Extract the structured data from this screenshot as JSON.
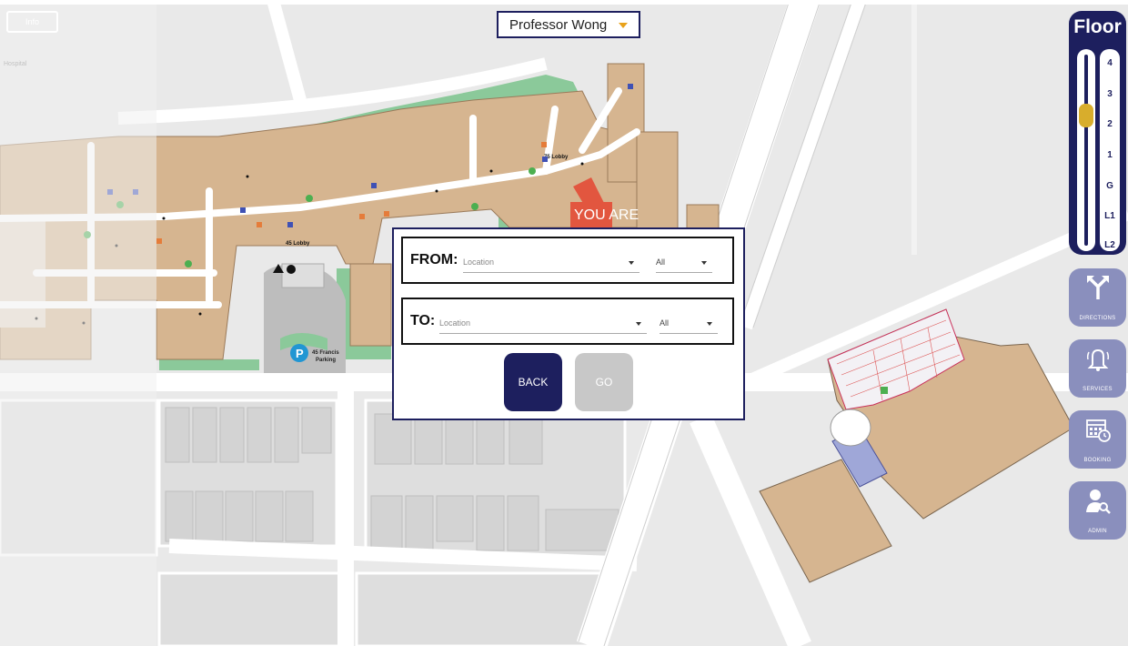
{
  "header": {
    "info_label": "Info",
    "user_name": "Professor Wong"
  },
  "map": {
    "you_are_here": "YOU ARE",
    "parking_label": "45 Francis Parking",
    "lobby_75": "75 Lobby",
    "lobby_45": "45 Lobby",
    "hospital_label": "Hospital"
  },
  "floor": {
    "title": "Floor",
    "levels": [
      "4",
      "3",
      "2",
      "1",
      "G",
      "L1",
      "L2"
    ],
    "selected": "2"
  },
  "side_buttons": [
    {
      "label": "DIRECTIONS",
      "icon": "directions-icon"
    },
    {
      "label": "SERVICES",
      "icon": "bell-icon"
    },
    {
      "label": "BOOKING",
      "icon": "calendar-icon"
    },
    {
      "label": "ADMIN",
      "icon": "admin-user-icon"
    }
  ],
  "dialog": {
    "from_label": "FROM:",
    "from_location_placeholder": "Location",
    "from_filter": "All",
    "to_label": "TO:",
    "to_location_placeholder": "Location",
    "to_filter": "All",
    "back_label": "BACK",
    "go_label": "GO"
  },
  "colors": {
    "navy": "#1d1f5e",
    "button_lilac": "#8a8fbd",
    "building_tan": "#d6b590",
    "green_space": "#8bc99a",
    "thumb_gold": "#d8ad2c",
    "marker_red": "#e2563f"
  }
}
